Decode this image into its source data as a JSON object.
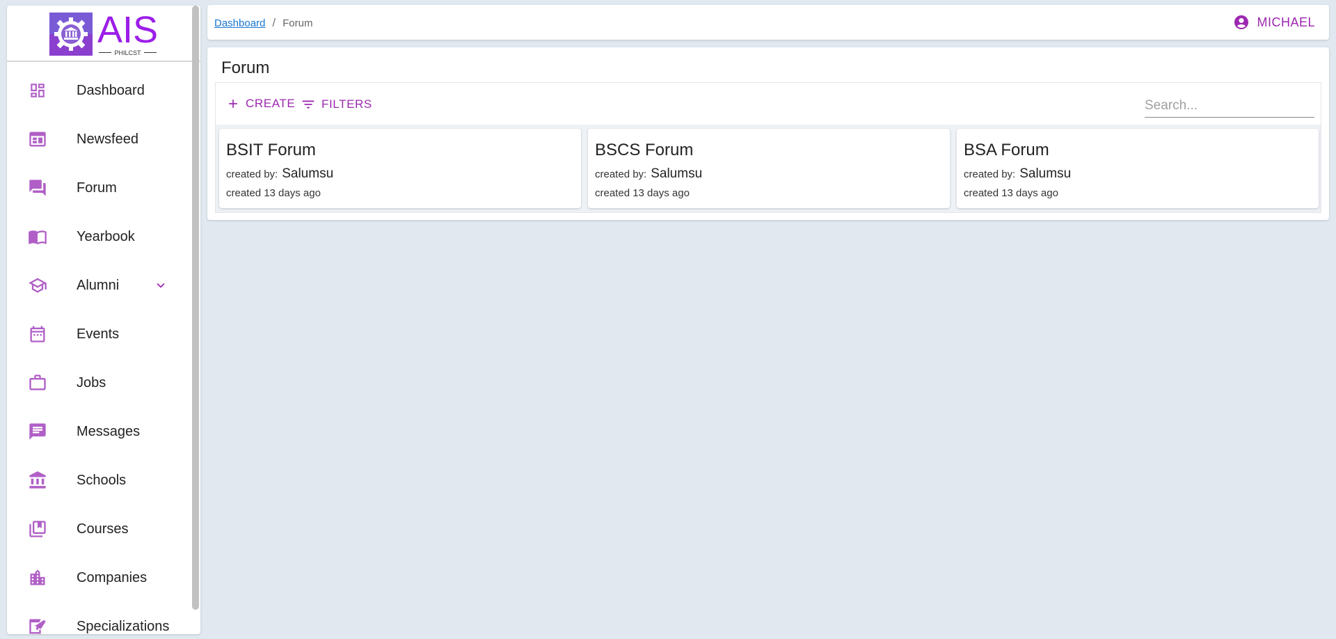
{
  "logo": {
    "title": "AIS",
    "subtitle": "PHILCST"
  },
  "sidebar": {
    "items": [
      {
        "label": "Dashboard",
        "icon": "dashboard-icon"
      },
      {
        "label": "Newsfeed",
        "icon": "newsfeed-icon"
      },
      {
        "label": "Forum",
        "icon": "forum-icon"
      },
      {
        "label": "Yearbook",
        "icon": "book-icon"
      },
      {
        "label": "Alumni",
        "icon": "graduation-cap-icon"
      },
      {
        "label": "Events",
        "icon": "calendar-icon"
      },
      {
        "label": "Jobs",
        "icon": "briefcase-icon"
      },
      {
        "label": "Messages",
        "icon": "message-icon"
      },
      {
        "label": "Schools",
        "icon": "bank-icon"
      },
      {
        "label": "Courses",
        "icon": "library-icon"
      },
      {
        "label": "Companies",
        "icon": "building-icon"
      },
      {
        "label": "Specializations",
        "icon": "specialization-icon"
      }
    ]
  },
  "breadcrumb": {
    "home": "Dashboard",
    "separator": "/",
    "current": "Forum"
  },
  "user": {
    "name": "MICHAEL"
  },
  "page": {
    "title": "Forum"
  },
  "toolbar": {
    "create_label": "CREATE",
    "filters_label": "FILTERS",
    "search_placeholder": "Search..."
  },
  "forums": [
    {
      "title": "BSIT Forum",
      "by_label": "created by:",
      "author": "Salumsu",
      "created": "created 13 days ago"
    },
    {
      "title": "BSCS Forum",
      "by_label": "created by:",
      "author": "Salumsu",
      "created": "created 13 days ago"
    },
    {
      "title": "BSA Forum",
      "by_label": "created by:",
      "author": "Salumsu",
      "created": "created 13 days ago"
    }
  ],
  "colors": {
    "accent": "#9c27b0",
    "icon": "#b05fc6",
    "link": "#1976d2",
    "background": "#e1e8f0"
  }
}
